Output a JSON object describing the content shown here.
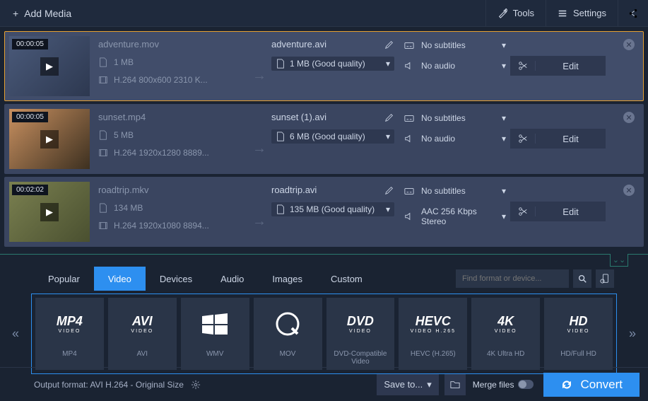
{
  "topbar": {
    "add_media": "Add Media",
    "tools": "Tools",
    "settings": "Settings"
  },
  "items": [
    {
      "timestamp": "00:00:05",
      "filename": "adventure.mov",
      "size": "1 MB",
      "codec": "H.264 800x600 2310 K...",
      "out_name": "adventure.avi",
      "out_size": "1 MB (Good quality)",
      "subtitles": "No subtitles",
      "audio": "No audio",
      "edit": "Edit"
    },
    {
      "timestamp": "00:00:05",
      "filename": "sunset.mp4",
      "size": "5 MB",
      "codec": "H.264 1920x1280 8889...",
      "out_name": "sunset (1).avi",
      "out_size": "6 MB (Good quality)",
      "subtitles": "No subtitles",
      "audio": "No audio",
      "edit": "Edit"
    },
    {
      "timestamp": "00:02:02",
      "filename": "roadtrip.mkv",
      "size": "134 MB",
      "codec": "H.264 1920x1080 8894...",
      "out_name": "roadtrip.avi",
      "out_size": "135 MB (Good quality)",
      "subtitles": "No subtitles",
      "audio": "AAC 256 Kbps Stereo",
      "edit": "Edit"
    }
  ],
  "tabs": {
    "popular": "Popular",
    "video": "Video",
    "devices": "Devices",
    "audio": "Audio",
    "images": "Images",
    "custom": "Custom"
  },
  "search": {
    "placeholder": "Find format or device..."
  },
  "formats": [
    {
      "main": "MP4",
      "sub": "VIDEO",
      "label": "MP4"
    },
    {
      "main": "AVI",
      "sub": "VIDEO",
      "label": "AVI"
    },
    {
      "main": "",
      "sub": "",
      "label": "WMV"
    },
    {
      "main": "",
      "sub": "",
      "label": "MOV"
    },
    {
      "main": "DVD",
      "sub": "VIDEO",
      "label": "DVD-Compatible Video"
    },
    {
      "main": "HEVC",
      "sub": "VIDEO H.265",
      "label": "HEVC (H.265)"
    },
    {
      "main": "4K",
      "sub": "VIDEO",
      "label": "4K Ultra HD"
    },
    {
      "main": "HD",
      "sub": "VIDEO",
      "label": "HD/Full HD"
    }
  ],
  "bottom": {
    "output_format": "Output format: AVI H.264 - Original Size",
    "save_to": "Save to...",
    "merge_files": "Merge files",
    "convert": "Convert"
  }
}
